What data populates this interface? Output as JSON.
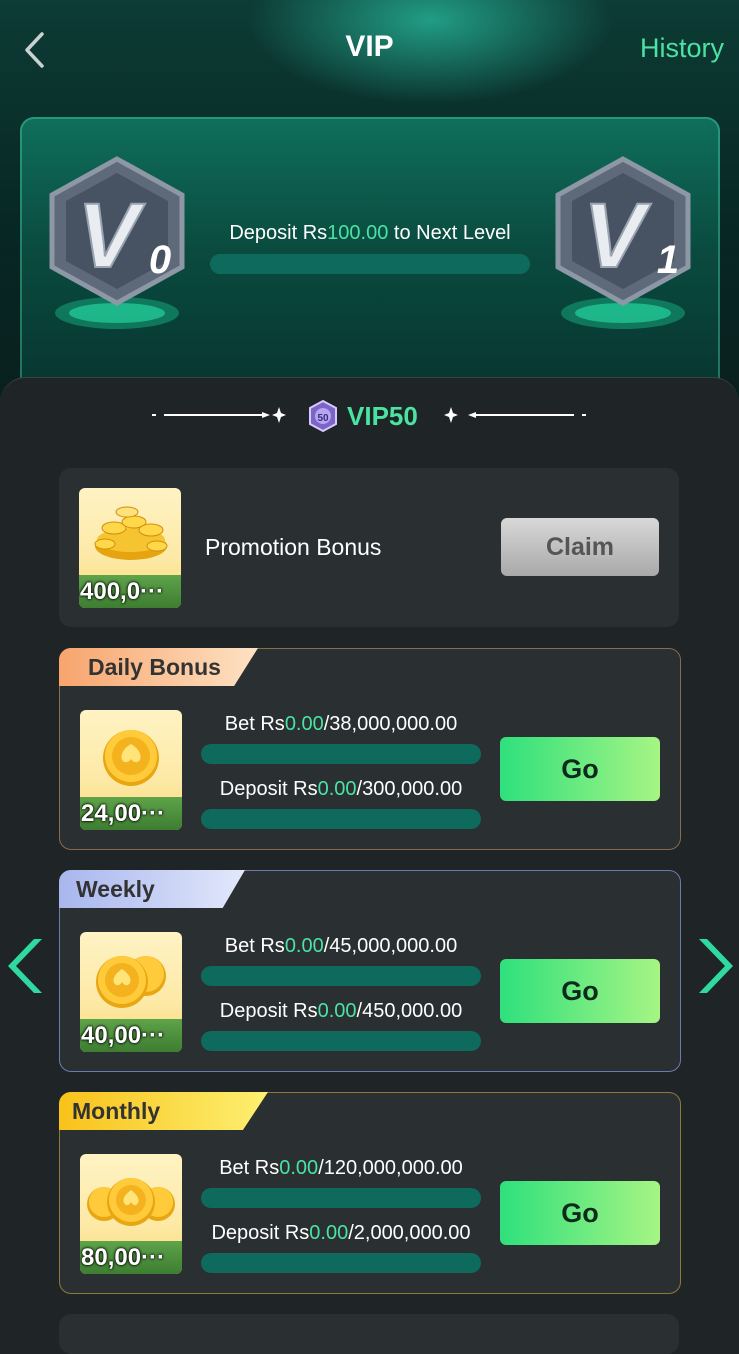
{
  "header": {
    "title": "VIP",
    "history_label": "History",
    "back_icon": "back-arrow-icon"
  },
  "level_progress": {
    "current_badge": "V0",
    "next_badge": "V1",
    "text_prefix": "Deposit Rs",
    "amount": "100.00",
    "text_suffix": " to Next Level",
    "progress_fraction": 0
  },
  "vip_level": {
    "label": "VIP50",
    "emblem_text": "50"
  },
  "promotion": {
    "amount": "400,0···",
    "label": "Promotion Bonus",
    "claim_label": "Claim"
  },
  "bonuses": [
    {
      "tab": "Daily Bonus",
      "amount": "24,00···",
      "bet_prefix": "Bet Rs",
      "bet_current": "0.00",
      "bet_target": "/38,000,000.00",
      "dep_prefix": "Deposit Rs",
      "dep_current": "0.00",
      "dep_target": "/300,000.00",
      "go_label": "Go"
    },
    {
      "tab": "Weekly Bonus",
      "amount": "40,00···",
      "bet_prefix": "Bet Rs",
      "bet_current": "0.00",
      "bet_target": "/45,000,000.00",
      "dep_prefix": "Deposit Rs",
      "dep_current": "0.00",
      "dep_target": "/450,000.00",
      "go_label": "Go"
    },
    {
      "tab": "Monthly Bonus",
      "amount": "80,00···",
      "bet_prefix": "Bet Rs",
      "bet_current": "0.00",
      "bet_target": "/120,000,000.00",
      "dep_prefix": "Deposit Rs",
      "dep_current": "0.00",
      "dep_target": "/2,000,000.00",
      "go_label": "Go"
    }
  ],
  "colors": {
    "accent": "#4ae3a2",
    "panel": "#2a2f31",
    "background": "#1f2426",
    "progress_track": "#0d6a5c"
  }
}
